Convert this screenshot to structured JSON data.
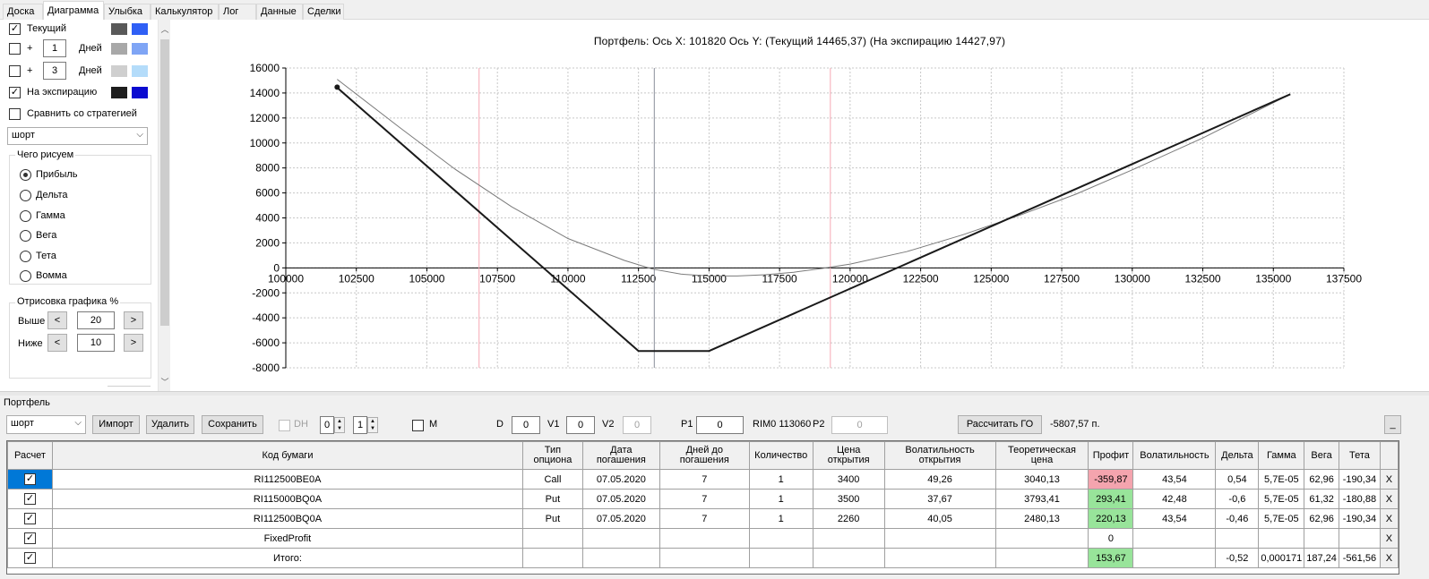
{
  "tabs": [
    {
      "label": "Доска",
      "active": false
    },
    {
      "label": "Диаграмма",
      "active": true
    },
    {
      "label": "Улыбка",
      "active": false
    },
    {
      "label": "Калькулятор",
      "active": false
    },
    {
      "label": "Лог",
      "active": false
    },
    {
      "label": "Данные",
      "active": false
    },
    {
      "label": "Сделки",
      "active": false
    }
  ],
  "left": {
    "current": {
      "label": "Текущий",
      "checked": true,
      "color1": "#595959",
      "color2": "#2f5ff5"
    },
    "plus1": {
      "plus": "+",
      "value": "1",
      "unit": "Дней",
      "checked": false,
      "color1": "#a8a8a8",
      "color2": "#7fa5f5"
    },
    "plus3": {
      "plus": "+",
      "value": "3",
      "unit": "Дней",
      "checked": false,
      "color1": "#cfcfcf",
      "color2": "#b4dcfa"
    },
    "expiry": {
      "label": "На экспирацию",
      "checked": true,
      "color1": "#1e1e1e",
      "color2": "#0a0ad0"
    },
    "compare": {
      "label": "Сравнить со стратегией",
      "checked": false
    },
    "strategy_select": "шорт",
    "draw_group": {
      "title": "Чего рисуем",
      "options": [
        "Прибыль",
        "Дельта",
        "Гамма",
        "Вега",
        "Тета",
        "Вомма"
      ],
      "selected": 0
    },
    "render_group": {
      "title": "Отрисовка графика %",
      "above_label": "Выше",
      "above_value": "20",
      "below_label": "Ниже",
      "below_value": "10",
      "dec": "<",
      "inc": ">"
    }
  },
  "chart_title": "Портфель: Ось X: 101820 Ось Y:  (Текущий 14465,37)  (На экспирацию 14427,97)",
  "chart_data": {
    "type": "line",
    "title": "Портфель: Ось X: 101820 Ось Y:  (Текущий 14465,37)  (На экспирацию 14427,97)",
    "xlim": [
      100000,
      137500
    ],
    "ylim": [
      -8000,
      16000
    ],
    "xticks": [
      100000,
      102500,
      105000,
      107500,
      110000,
      112500,
      115000,
      117500,
      120000,
      122500,
      125000,
      127500,
      130000,
      132500,
      135000,
      137500
    ],
    "yticks": [
      -8000,
      -6000,
      -4000,
      -2000,
      0,
      2000,
      4000,
      6000,
      8000,
      10000,
      12000,
      14000,
      16000
    ],
    "grid": true,
    "vertical_lines": [
      {
        "x": 106850,
        "color": "#f7a8b4"
      },
      {
        "x": 113060,
        "color": "#8a8f9a"
      },
      {
        "x": 119300,
        "color": "#f7a8b4"
      }
    ],
    "series": [
      {
        "color": "#7a7a7a",
        "width": 1,
        "x": [
          101820,
          104000,
          106000,
          108000,
          110000,
          112000,
          113000,
          114000,
          115000,
          116000,
          117000,
          118000,
          119000,
          120000,
          122000,
          124000,
          126000,
          128000,
          130000,
          132500,
          135600
        ],
        "y": [
          15100,
          11300,
          7900,
          4900,
          2350,
          600,
          -100,
          -500,
          -650,
          -650,
          -550,
          -350,
          -50,
          300,
          1300,
          2650,
          4200,
          5900,
          7850,
          10400,
          13900
        ]
      },
      {
        "color": "#1a1a1a",
        "width": 2,
        "x": [
          101820,
          112500,
          115000,
          135600
        ],
        "y": [
          14430,
          -6650,
          -6650,
          13900
        ]
      }
    ],
    "marker": {
      "x": 101820,
      "y": 14465
    }
  },
  "portfolio": {
    "label": "Портфель",
    "select": "шорт",
    "import_btn": "Импорт",
    "delete_btn": "Удалить",
    "save_btn": "Сохранить",
    "dh_label": "DH",
    "dh1": "0",
    "dh2": "1",
    "m_label": "M",
    "d_label": "D",
    "d_value": "0",
    "v1_label": "V1",
    "v1_value": "0",
    "v2_label": "V2",
    "v2_value": "0",
    "p1_label": "P1",
    "p1_value": "0",
    "rim_text": "RIM0 113060",
    "p2_label": "P2",
    "p2_value": "0",
    "calc_go_btn": "Рассчитать ГО",
    "go_value": "-5807,57 п.",
    "min_btn": "_"
  },
  "table": {
    "headers": [
      "Расчет",
      "Код бумаги",
      "Тип опциона",
      "Дата погашения",
      "Дней до погашения",
      "Количество",
      "Цена открытия",
      "Волатильность открытия",
      "Теоретическая цена",
      "Профит",
      "Волатильность",
      "Дельта",
      "Гамма",
      "Вега",
      "Тета",
      ""
    ],
    "rows": [
      {
        "check": "☑",
        "code": "RI112500BE0A",
        "type": "Call",
        "date": "07.05.2020",
        "days": "7",
        "qty": "1",
        "open": "3400",
        "vol_open": "49,26",
        "theor": "3040,13",
        "profit": "-359,87",
        "profit_state": "neg",
        "vol": "43,54",
        "delta": "0,54",
        "gamma": "5,7E-05",
        "vega": "62,96",
        "theta": "-190,34",
        "x": "X"
      },
      {
        "check": "☑",
        "code": "RI115000BQ0A",
        "type": "Put",
        "date": "07.05.2020",
        "days": "7",
        "qty": "1",
        "open": "3500",
        "vol_open": "37,67",
        "theor": "3793,41",
        "profit": "293,41",
        "profit_state": "pos",
        "vol": "42,48",
        "delta": "-0,6",
        "gamma": "5,7E-05",
        "vega": "61,32",
        "theta": "-180,88",
        "x": "X"
      },
      {
        "check": "☑",
        "code": "RI112500BQ0A",
        "type": "Put",
        "date": "07.05.2020",
        "days": "7",
        "qty": "1",
        "open": "2260",
        "vol_open": "40,05",
        "theor": "2480,13",
        "profit": "220,13",
        "profit_state": "pos",
        "vol": "43,54",
        "delta": "-0,46",
        "gamma": "5,7E-05",
        "vega": "62,96",
        "theta": "-190,34",
        "x": "X"
      },
      {
        "check": "☑",
        "code": "FixedProfit",
        "type": "",
        "date": "",
        "days": "",
        "qty": "",
        "open": "",
        "vol_open": "",
        "theor": "",
        "profit": "0",
        "profit_state": "",
        "vol": "",
        "delta": "",
        "gamma": "",
        "vega": "",
        "theta": "",
        "x": "X"
      },
      {
        "check": "☑",
        "code": "Итого:",
        "type": "",
        "date": "",
        "days": "",
        "qty": "",
        "open": "",
        "vol_open": "",
        "theor": "",
        "profit": "153,67",
        "profit_state": "pos",
        "vol": "",
        "delta": "-0,52",
        "gamma": "0,000171",
        "vega": "187,24",
        "theta": "-561,56",
        "x": "X"
      }
    ]
  }
}
